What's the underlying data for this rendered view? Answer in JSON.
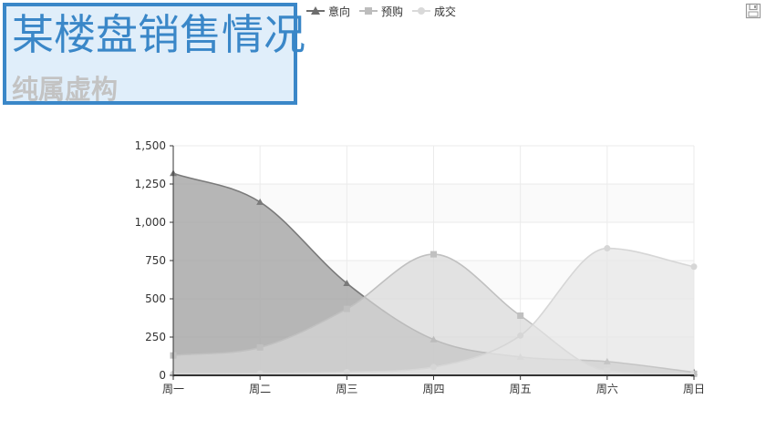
{
  "title": "某楼盘销售情况",
  "subtitle": "纯属虚构",
  "legend": [
    {
      "name": "意向",
      "marker": "triangle",
      "color": "#6e6e6e"
    },
    {
      "name": "预购",
      "marker": "square",
      "color": "#bdbdbd"
    },
    {
      "name": "成交",
      "marker": "circle",
      "color": "#d9d9d9"
    }
  ],
  "toolbar": {
    "save_icon": "save-icon"
  },
  "chart_data": {
    "type": "area",
    "smooth": true,
    "categories": [
      "周一",
      "周二",
      "周三",
      "周四",
      "周五",
      "周六",
      "周日"
    ],
    "series": [
      {
        "name": "意向",
        "values": [
          1320,
          1132,
          601,
          234,
          120,
          90,
          20
        ],
        "line": "#7a7a7a",
        "fill": "#a9a9a9",
        "fill_opacity": 0.85,
        "marker": "triangle"
      },
      {
        "name": "预购",
        "values": [
          130,
          182,
          434,
          791,
          390,
          30,
          10
        ],
        "line": "#c0c0c0",
        "fill": "#d7d7d7",
        "fill_opacity": 0.7,
        "marker": "square"
      },
      {
        "name": "成交",
        "values": [
          10,
          12,
          21,
          54,
          260,
          830,
          710
        ],
        "line": "#d6d6d6",
        "fill": "#e6e6e6",
        "fill_opacity": 0.7,
        "marker": "circle"
      }
    ],
    "y_ticks": [
      "0",
      "250",
      "500",
      "750",
      "1,000",
      "1,250",
      "1,500"
    ],
    "ylim": [
      0,
      1500
    ],
    "grid": true,
    "split_area": true,
    "legend_position": "top"
  }
}
